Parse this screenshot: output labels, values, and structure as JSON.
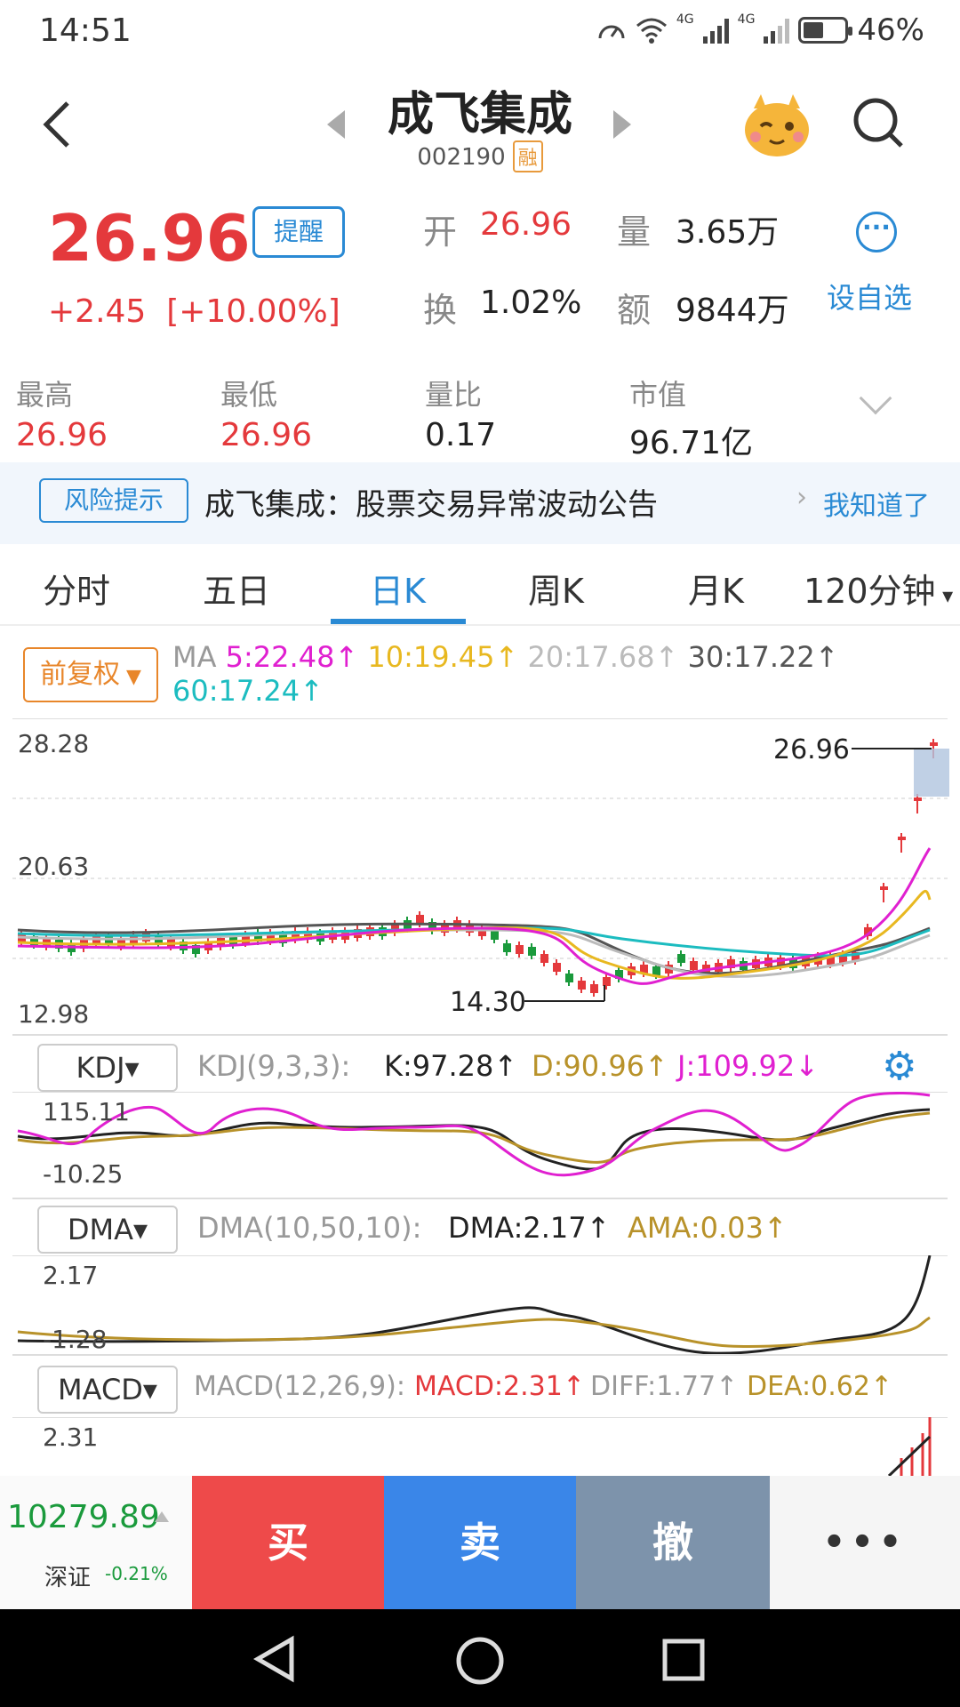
{
  "status_bar": {
    "time": "14:51",
    "battery": "46%",
    "net1": "4G",
    "net2": "4G"
  },
  "header": {
    "stock_name": "成飞集成",
    "stock_code": "002190",
    "margin_tag": "融"
  },
  "quote": {
    "price": "26.96",
    "change": "+2.45",
    "change_pct": "[+10.00%]",
    "remind_label": "提醒",
    "open_label": "开",
    "open_value": "26.96",
    "volume_label": "量",
    "volume_value": "3.65万",
    "turnover_label": "换",
    "turnover_value": "1.02%",
    "amount_label": "额",
    "amount_value": "9844万",
    "add_watchlist_label": "设自选"
  },
  "stats": {
    "high_label": "最高",
    "high_value": "26.96",
    "low_label": "最低",
    "low_value": "26.96",
    "volume_ratio_label": "量比",
    "volume_ratio_value": "0.17",
    "market_cap_label": "市值",
    "market_cap_value": "96.71亿"
  },
  "risk": {
    "tag": "风险提示",
    "text": "成飞集成：股票交易异常波动公告",
    "ack": "我知道了"
  },
  "tabs": [
    "分时",
    "五日",
    "日K",
    "周K",
    "月K",
    "120分钟"
  ],
  "active_tab": "日K",
  "ma_legend": {
    "adjust_label": "前复权",
    "prefix": "MA",
    "ma5": "5:22.48↑",
    "ma10": "10:19.45↑",
    "ma20": "20:17.68↑",
    "ma30": "30:17.22↑",
    "ma60": "60:17.24↑"
  },
  "kline": {
    "y_max": "28.28",
    "y_mid": "20.63",
    "y_min": "12.98",
    "high_marker": "26.96",
    "low_marker": "14.30"
  },
  "kdj": {
    "button": "KDJ▾",
    "params": "KDJ(9,3,3):",
    "k": "K:97.28↑",
    "d": "D:90.96↑",
    "j": "J:109.92↓",
    "y_max": "115.11",
    "y_min": "-10.25"
  },
  "dma": {
    "button": "DMA▾",
    "params": "DMA(10,50,10):",
    "dma": "DMA:2.17↑",
    "ama": "AMA:0.03↑",
    "y_max": "2.17",
    "y_min": "-1.28"
  },
  "macd": {
    "button": "MACD▾",
    "params": "MACD(12,26,9):",
    "macd": "MACD:2.31↑",
    "diff": "DIFF:1.77↑",
    "dea": "DEA:0.62↑",
    "y_max": "2.31"
  },
  "bottom_bar": {
    "index_value": "10279.89",
    "index_name": "深证",
    "index_change": "-0.21%",
    "buy": "买",
    "sell": "卖",
    "cancel": "撤",
    "more": "•••"
  },
  "colors": {
    "up": "#e4393c",
    "down": "#1a9a3c",
    "accent": "#2a8ad4",
    "ma5": "#e020d0",
    "ma10": "#e8b820",
    "ma20": "#bbbbbb",
    "ma30": "#555555",
    "ma60": "#1cbcc0"
  }
}
